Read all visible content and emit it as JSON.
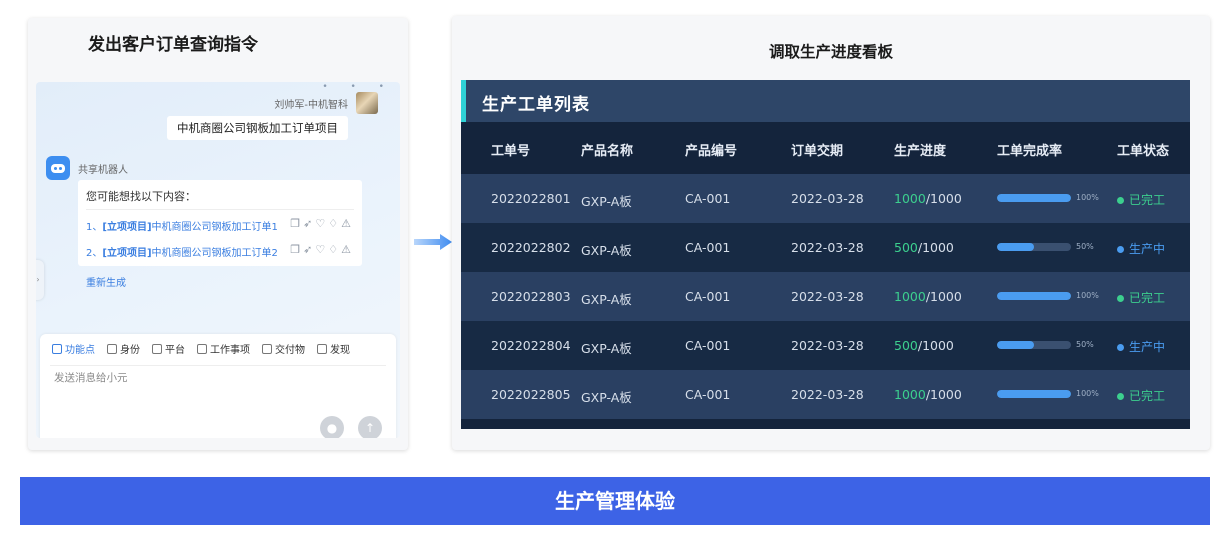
{
  "left_panel": {
    "title": "发出客户订单查询指令",
    "user_name": "刘帅军-中机智科",
    "user_message": "中机商圈公司钢板加工订单项目",
    "bot_name": "共享机器人",
    "bot_intro": "您可能想找以下内容：",
    "results": [
      {
        "index": "1、",
        "tag": "[立项项目]",
        "text": "中机商圈公司钢板加工订单1"
      },
      {
        "index": "2、",
        "tag": "[立项项目]",
        "text": "中机商圈公司钢板加工订单2"
      }
    ],
    "result_icons": [
      "copy-icon",
      "send-icon",
      "thumbs-up-icon",
      "thumbs-down-icon",
      "warning-icon"
    ],
    "regenerate": "重新生成",
    "toolbar": [
      {
        "label": "功能点",
        "active": true
      },
      {
        "label": "身份",
        "active": false
      },
      {
        "label": "平台",
        "active": false
      },
      {
        "label": "工作事项",
        "active": false
      },
      {
        "label": "交付物",
        "active": false
      },
      {
        "label": "发现",
        "active": false
      }
    ],
    "input_placeholder": "发送消息给小元"
  },
  "right_panel": {
    "title": "调取生产进度看板",
    "board_title": "生产工单列表",
    "columns": [
      "工单号",
      "产品名称",
      "产品编号",
      "订单交期",
      "生产进度",
      "工单完成率",
      "工单状态"
    ],
    "rows": [
      {
        "order_no": "2022022801",
        "product_name": "GXP-A板",
        "product_code": "CA-001",
        "due_date": "2022-03-28",
        "progress_done": "1000",
        "progress_total": "/1000",
        "completion": 1.0,
        "completion_label": "100%",
        "status": "已完工",
        "status_color": "#3ccf8e"
      },
      {
        "order_no": "2022022802",
        "product_name": "GXP-A板",
        "product_code": "CA-001",
        "due_date": "2022-03-28",
        "progress_done": "500",
        "progress_total": "/1000",
        "completion": 0.5,
        "completion_label": "50%",
        "status": "生产中",
        "status_color": "#4a9cf0"
      },
      {
        "order_no": "2022022803",
        "product_name": "GXP-A板",
        "product_code": "CA-001",
        "due_date": "2022-03-28",
        "progress_done": "1000",
        "progress_total": "/1000",
        "completion": 1.0,
        "completion_label": "100%",
        "status": "已完工",
        "status_color": "#3ccf8e"
      },
      {
        "order_no": "2022022804",
        "product_name": "GXP-A板",
        "product_code": "CA-001",
        "due_date": "2022-03-28",
        "progress_done": "500",
        "progress_total": "/1000",
        "completion": 0.5,
        "completion_label": "50%",
        "status": "生产中",
        "status_color": "#4a9cf0"
      },
      {
        "order_no": "2022022805",
        "product_name": "GXP-A板",
        "product_code": "CA-001",
        "due_date": "2022-03-28",
        "progress_done": "1000",
        "progress_total": "/1000",
        "completion": 1.0,
        "completion_label": "100%",
        "status": "已完工",
        "status_color": "#3ccf8e"
      }
    ]
  },
  "banner": "生产管理体验",
  "colors": {
    "accent": "#3d63e6",
    "board_bg": "#14243c",
    "done": "#3ccf8e",
    "in_progress": "#4a9cf0",
    "link": "#3a7ee0"
  }
}
